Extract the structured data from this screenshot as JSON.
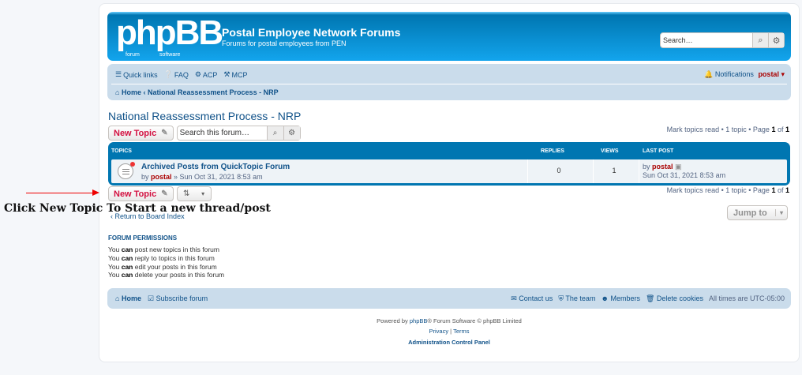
{
  "header": {
    "logo_text": "phpBB",
    "logo_sub1": "forum",
    "logo_sub2": "software",
    "site_title": "Postal Employee Network Forums",
    "site_description": "Forums for postal employees from PEN",
    "search_placeholder": "Search…"
  },
  "navbar": {
    "quick_links": "Quick links",
    "faq": "FAQ",
    "acp": "ACP",
    "mcp": "MCP",
    "notifications": "Notifications",
    "username": "postal",
    "home": "Home",
    "forum_crumb": "National Reassessment Process - NRP"
  },
  "forum": {
    "title": "National Reassessment Process - NRP",
    "new_topic": "New Topic",
    "search_placeholder": "Search this forum…",
    "pagination_pre": "Mark topics read • 1 topic • Page ",
    "page": "1",
    "of": " of ",
    "pages": "1"
  },
  "table": {
    "col_topics": "TOPICS",
    "col_replies": "REPLIES",
    "col_views": "VIEWS",
    "col_last_post": "LAST POST",
    "rows": [
      {
        "title": "Archived Posts from QuickTopic Forum",
        "by": "by ",
        "author": "postal",
        "date": " » Sun Oct 31, 2021 8:53 am",
        "replies": "0",
        "views": "1",
        "last_by": "by ",
        "last_author": "postal",
        "last_date": "Sun Oct 31, 2021 8:53 am"
      }
    ]
  },
  "annotation": {
    "text": "Click New Topic To Start a new thread/post"
  },
  "bottom": {
    "return_link": "Return to Board Index",
    "jump_to": "Jump to"
  },
  "permissions": {
    "heading": "FORUM PERMISSIONS",
    "lines": [
      {
        "pre": "You ",
        "can": "can",
        "post": " post new topics in this forum"
      },
      {
        "pre": "You ",
        "can": "can",
        "post": " reply to topics in this forum"
      },
      {
        "pre": "You ",
        "can": "can",
        "post": " edit your posts in this forum"
      },
      {
        "pre": "You ",
        "can": "can",
        "post": " delete your posts in this forum"
      }
    ]
  },
  "footer": {
    "home": "Home",
    "subscribe": "Subscribe forum",
    "contact": "Contact us",
    "team": "The team",
    "members": "Members",
    "delete_cookies": "Delete cookies",
    "timezone": "All times are UTC-05:00",
    "powered_pre": "Powered by ",
    "phpbb": "phpBB",
    "powered_post": "® Forum Software © phpBB Limited",
    "privacy": "Privacy",
    "sep": " | ",
    "terms": "Terms",
    "acp": "Administration Control Panel"
  }
}
